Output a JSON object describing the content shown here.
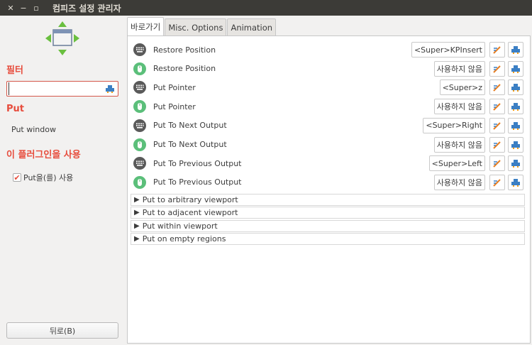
{
  "window": {
    "title": "컴피즈 설정 관리자"
  },
  "sidebar": {
    "filter_title": "필터",
    "filter_value": "",
    "category_title": "Put",
    "plugin_name": "Put window",
    "enable_title": "이 플러그인을 사용",
    "enable_label": "Put을(를) 사용",
    "enable_checked": true,
    "back_label": "뒤로(B)"
  },
  "tabs": [
    {
      "label": "바로가기",
      "active": true
    },
    {
      "label": "Misc. Options",
      "active": false
    },
    {
      "label": "Animation",
      "active": false
    }
  ],
  "bindings": [
    {
      "label": "Restore Position",
      "type": "keyboard",
      "value": "<Super>KPInsert"
    },
    {
      "label": "Restore Position",
      "type": "mouse",
      "value": "사용하지 않음"
    },
    {
      "label": "Put Pointer",
      "type": "keyboard",
      "value": "<Super>z"
    },
    {
      "label": "Put Pointer",
      "type": "mouse",
      "value": "사용하지 않음"
    },
    {
      "label": "Put To Next Output",
      "type": "keyboard",
      "value": "<Super>Right"
    },
    {
      "label": "Put To Next Output",
      "type": "mouse",
      "value": "사용하지 않음"
    },
    {
      "label": "Put To Previous Output",
      "type": "keyboard",
      "value": "<Super>Left"
    },
    {
      "label": "Put To Previous Output",
      "type": "mouse",
      "value": "사용하지 않음"
    }
  ],
  "expanders": [
    {
      "label": "Put to arbitrary viewport"
    },
    {
      "label": "Put to adjacent viewport"
    },
    {
      "label": "Put within viewport"
    },
    {
      "label": "Put on empty regions"
    }
  ],
  "colors": {
    "accent": "#e74c3c",
    "titlebar": "#3c3b37",
    "mouse_icon": "#5bbf7a",
    "keyboard_icon": "#5a5a5a"
  },
  "icons": {
    "keyboard": "keyboard-icon",
    "mouse": "mouse-icon",
    "edit": "pencil-icon",
    "clear": "clear-icon"
  }
}
